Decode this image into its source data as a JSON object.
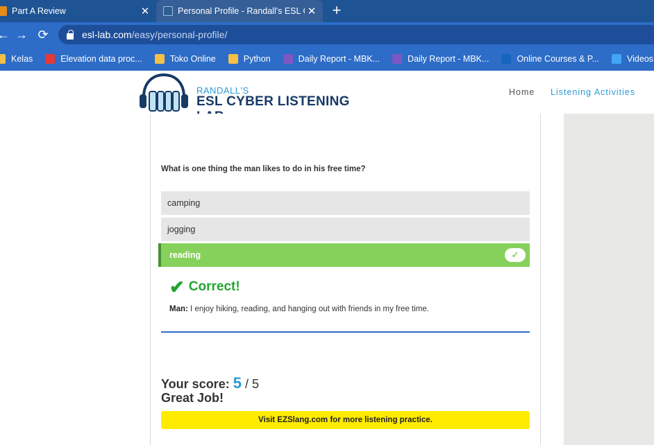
{
  "browser": {
    "tabs": [
      {
        "title": "Part A Review",
        "close": "✕"
      },
      {
        "title": "Personal Profile - Randall's ESL C",
        "close": "✕"
      }
    ],
    "new_tab": "+",
    "nav": {
      "back": "←",
      "forward": "→",
      "reload": "⟳"
    },
    "url": {
      "domain": "esl-lab.com",
      "path": "/easy/personal-profile/"
    },
    "bookmarks": [
      {
        "label": "Kelas",
        "color": "#f4c048"
      },
      {
        "label": "Elevation data proc...",
        "color": "#e53935"
      },
      {
        "label": "Toko Online",
        "color": "#f4c048"
      },
      {
        "label": "Python",
        "color": "#f4c048"
      },
      {
        "label": "Daily Report - MBK...",
        "color": "#7e57c2"
      },
      {
        "label": "Daily Report - MBK...",
        "color": "#7e57c2"
      },
      {
        "label": "Online Courses & P...",
        "color": "#1565c0"
      },
      {
        "label": "Videos and on",
        "color": "#42a5f5"
      }
    ]
  },
  "site": {
    "logo": {
      "small": "RANDALL'S",
      "big": "ESL CYBER LISTENING LAB"
    },
    "nav": {
      "home": "Home",
      "activities": "Listening Activities"
    }
  },
  "quiz": {
    "question": "What is one thing the man likes to do in his free time?",
    "options": [
      "camping",
      "jogging",
      "reading"
    ],
    "selected_check": "✓",
    "feedback": {
      "mark": "✔",
      "label": "Correct!"
    },
    "transcript": {
      "speaker": "Man:",
      "text": " I enjoy hiking, reading, and hanging out with friends in my free time."
    },
    "score": {
      "label": "Your score: ",
      "value": "5",
      "total": " / 5",
      "comment": "Great Job!"
    },
    "promo": "Visit EZSlang.com for more listening practice."
  },
  "colors": {
    "correct": "#22a52f",
    "selected": "#86d15c",
    "accent": "#2a9ad4",
    "promo": "#ffeb00"
  }
}
